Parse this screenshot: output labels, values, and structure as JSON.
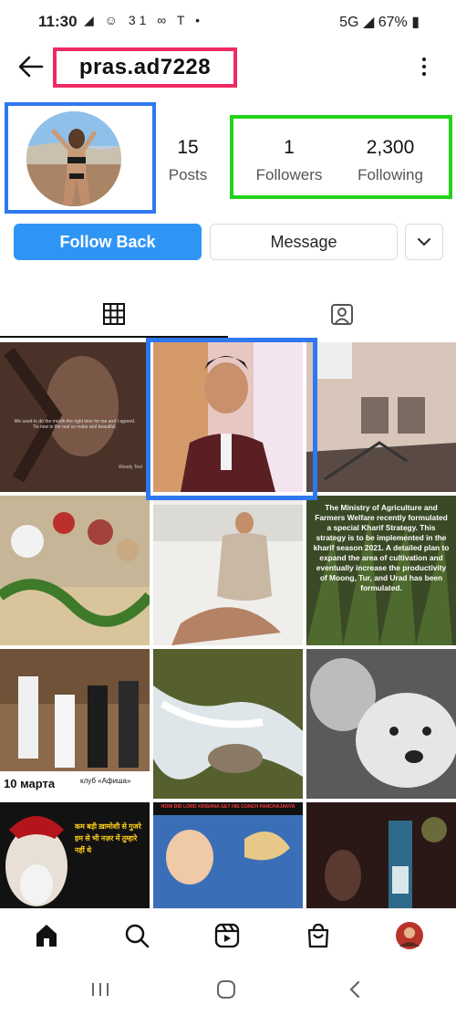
{
  "status_bar": {
    "time": "11:30",
    "network": "5G",
    "battery": "67%",
    "left_icons": "◢ ☺ 31 ∞ T •"
  },
  "profile": {
    "username": "pras.ad7228",
    "posts_count": "15",
    "posts_label": "Posts",
    "followers_count": "1",
    "followers_label": "Followers",
    "following_count": "2,300",
    "following_label": "Following"
  },
  "actions": {
    "follow_back": "Follow Back",
    "message": "Message"
  },
  "grid": {
    "tiles": [
      {
        "caption": "We used to do the mouth the right time for me and I agreed. Tis now is the real us make and beautiful.",
        "caption2": "Woody Text"
      },
      {
        "caption": ""
      },
      {
        "caption": ""
      },
      {
        "caption": ""
      },
      {
        "caption": ""
      },
      {
        "caption": "The Ministry of Agriculture and Farmers Welfare recently formulated a special Kharif Strategy. This strategy is to be implemented in the kharif season 2021. A detailed plan to expand the area of cultivation and eventually increase the productivity of Moong, Tur, and Urad has been formulated."
      },
      {
        "caption": "10 марта",
        "caption2": "клуб «Афиша»"
      },
      {
        "caption": ""
      },
      {
        "caption": ""
      },
      {
        "caption": "कम बड़ी ख़ामोशी से गुजरे हम से भी नज़र में तुम्हारे नहीं थे"
      },
      {
        "caption": "HOW DID LORD KRISHNA GET HIS CONCH PANCHAJANYA"
      },
      {
        "caption": ""
      }
    ]
  },
  "colors": {
    "accent": "#2f95f5",
    "username_box": "#ef2a62",
    "highlight_blue": "#2f78f0",
    "highlight_green": "#22d31b"
  }
}
